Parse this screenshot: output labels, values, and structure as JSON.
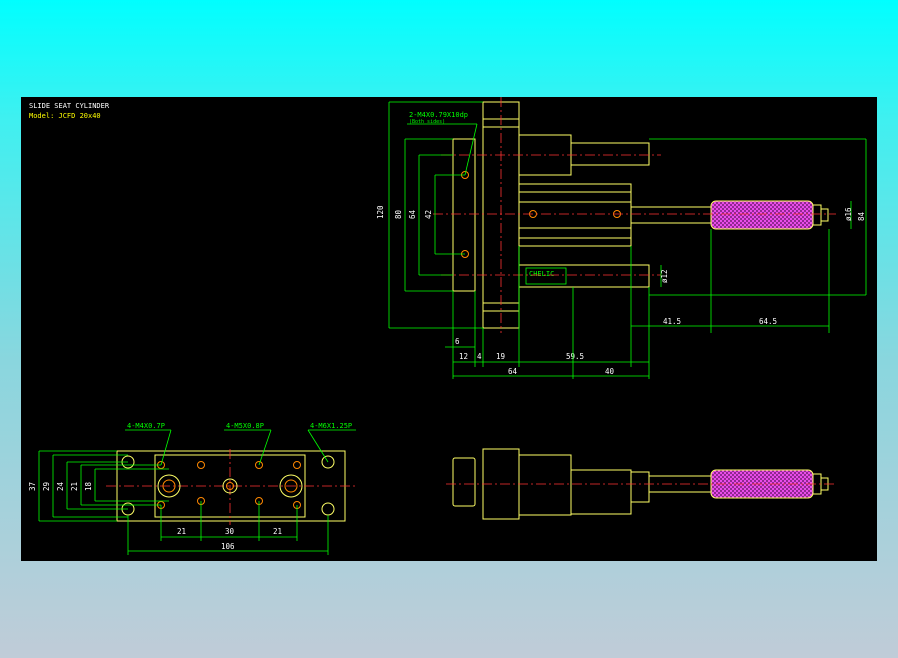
{
  "title": "SLIDE SEAT CYLINDER",
  "model": "Model:  JCFD 20x40",
  "brand": "CHELIC",
  "notes": {
    "top_hole": "2-M4X0.79X10dp",
    "top_hole_sub": "(Both sides)",
    "hole_a": "4-M4X0.7P",
    "hole_b": "4-M5X0.8P",
    "hole_c": "4-M6X1.25P"
  },
  "dims": {
    "d120": "120",
    "d80": "80",
    "d64v": "64",
    "d42": "42",
    "d6": "6",
    "d12": "12",
    "d4": "4",
    "d19": "19",
    "d59_5": "59.5",
    "d64h": "64",
    "d40": "40",
    "d41_5": "41.5",
    "d64_5": "64.5",
    "phi16": "ø16",
    "d84": "84",
    "phi12": "ø12",
    "d37": "37",
    "d29": "29",
    "d24": "24",
    "d21v": "21",
    "d18": "18",
    "d21a": "21",
    "d30": "30",
    "d21b": "21",
    "d106": "106"
  },
  "colors": {
    "outline": "#ffff66",
    "dimension": "#00ff00",
    "center": "#ff3333",
    "hole": "#ff8800",
    "knurl": "#cc33cc",
    "panel": "#000000"
  }
}
